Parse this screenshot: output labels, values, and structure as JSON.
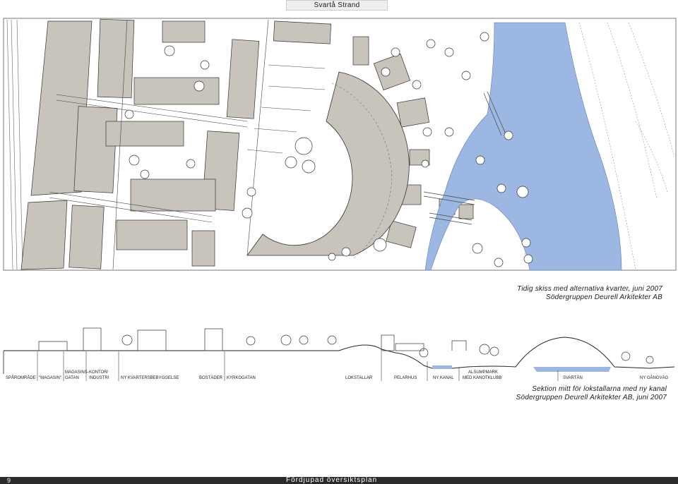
{
  "header": {
    "title": "Svartå Strand"
  },
  "plan": {
    "caption_line1": "Tidig skiss med alternativa kvarter, juni 2007",
    "caption_line2": "Södergruppen Deurell Arkitekter AB",
    "colors": {
      "water": "#9db7e3",
      "building": "#c8c3bb",
      "line": "#3a3a3a"
    }
  },
  "section": {
    "labels": {
      "sparomrade": "SPÅROMRÅDE",
      "magasin": "\"MAGASIN\"",
      "magasinsgatan_1": "MAGASINS-",
      "magasinsgatan_2": "GATAN",
      "kontor_1": "KONTOR/",
      "kontor_2": "INDUSTRI",
      "kvarter": "NY KVARTERSBEBYGGELSE",
      "bostader": "BOSTÄDER",
      "kyrkogatan": "KYRKOGATAN",
      "lokstallar": "LOKSTALLAR",
      "pelarhus": "PELARHUS",
      "kanal": "NY KANAL",
      "alsumpmark_1": "ALSUMPMARK",
      "alsumpmark_2": "MED KANOTKLUBB",
      "svartan": "SVARTÅN",
      "gangvag": "NY GÅNGVÄG"
    },
    "caption_line1": "Sektion mitt för lokstallarna med ny kanal",
    "caption_line2": "Södergruppen Deurell Arkitekter AB, juni 2007"
  },
  "footer": {
    "page_number": "9",
    "title": "Fördjupad översiktsplan"
  }
}
